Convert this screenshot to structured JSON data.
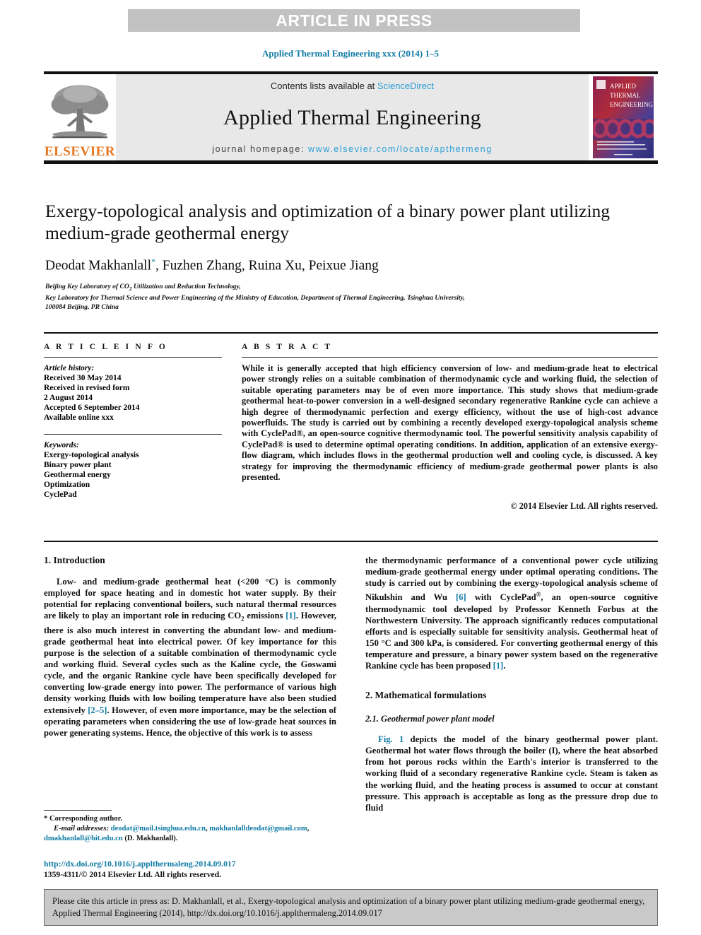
{
  "banner": {
    "text": "ARTICLE IN PRESS"
  },
  "running_head": "Applied Thermal Engineering xxx (2014) 1–5",
  "masthead": {
    "contents_prefix": "Contents lists available at ",
    "sciencedirect": "ScienceDirect",
    "journal_name": "Applied Thermal Engineering",
    "homepage_label": "journal homepage: ",
    "homepage_url": "www.elsevier.com/locate/apthermeng",
    "publisher": "ELSEVIER",
    "cover_title_lines": [
      "APPLIED",
      "THERMAL",
      "ENGINEERING"
    ],
    "link_color": "#2b9fd6",
    "band_color": "#e8e8e8"
  },
  "article": {
    "title": "Exergy-topological analysis and optimization of a binary power plant utilizing medium-grade geothermal energy",
    "authors": "Deodat Makhanlall",
    "corresponding_marker": "*",
    "authors_rest": ", Fuzhen Zhang, Ruina Xu, Peixue Jiang",
    "affiliations": [
      "Beijing Key Laboratory of CO2 Utilization and Reduction Technology,",
      "Key Laboratory for Thermal Science and Power Engineering of the Ministry of Education, Department of Thermal Engineering, Tsinghua University,",
      "100084 Beijing, PR China"
    ]
  },
  "info": {
    "heading": "A R T I C L E    I N F O",
    "history_label": "Article history:",
    "history": [
      "Received 30 May 2014",
      "Received in revised form",
      "2 August 2014",
      "Accepted 6 September 2014",
      "Available online xxx"
    ],
    "keywords_label": "Keywords:",
    "keywords": [
      "Exergy-topological analysis",
      "Binary power plant",
      "Geothermal energy",
      "Optimization",
      "CyclePad"
    ]
  },
  "abstract": {
    "heading": "A B S T R A C T",
    "text": "While it is generally accepted that high efficiency conversion of low- and medium-grade heat to electrical power strongly relies on a suitable combination of thermodynamic cycle and working fluid, the selection of suitable operating parameters may be of even more importance. This study shows that medium-grade geothermal heat-to-power conversion in a well-designed secondary regenerative Rankine cycle can achieve a high degree of thermodynamic perfection and exergy efficiency, without the use of high-cost advance powerfluids. The study is carried out by combining a recently developed exergy-topological analysis scheme with CyclePad®, an open-source cognitive thermodynamic tool. The powerful sensitivity analysis capability of CyclePad® is used to determine optimal operating conditions. In addition, application of an extensive exergy-flow diagram, which includes flows in the geothermal production well and cooling cycle, is discussed. A key strategy for improving the thermodynamic efficiency of medium-grade geothermal power plants is also presented.",
    "copyright": "© 2014 Elsevier Ltd. All rights reserved."
  },
  "body": {
    "section1_heading": "1. Introduction",
    "section1_p1_a": "Low- and medium-grade geothermal heat (<200 °C) is commonly employed for space heating and in domestic hot water supply. By their potential for replacing conventional boilers, such natural thermal resources are likely to play an important role in reducing CO",
    "section1_p1_sub": "2",
    "section1_p1_b": " emissions ",
    "ref1": "[1]",
    "section1_p1_c": ". However, there is also much interest in converting the abundant low- and medium-grade geothermal heat into electrical power. Of key importance for this purpose is the selection of a suitable combination of thermodynamic cycle and working fluid. Several cycles such as the Kaline cycle, the Goswami cycle, and the organic Rankine cycle have been specifically developed for converting low-grade energy into power. The performance of various high density working fluids with low boiling temperature have also been studied extensively ",
    "ref2_5": "[2–5]",
    "section1_p1_d": ". However, of even more importance, may be the selection of operating parameters when considering the use of low-grade heat sources in power generating systems. Hence, the objective of this work is to assess",
    "col2_p1_a": "the thermodynamic performance of a conventional power cycle utilizing medium-grade geothermal energy under optimal operating conditions. The study is carried out by combining the exergy-topological analysis scheme of Nikulshin and Wu ",
    "ref6": "[6]",
    "col2_p1_b": " with CyclePad",
    "col2_p1_c": ", an open-source cognitive thermodynamic tool developed by Professor Kenneth Forbus at the Northwestern University. The approach significantly reduces computational efforts and is especially suitable for sensitivity analysis. Geothermal heat of 150 °C and 300 kPa, is considered. For converting geothermal energy of this temperature and pressure, a binary power system based on the regenerative Rankine cycle has been proposed ",
    "ref1b": "[1]",
    "col2_p1_d": ".",
    "section2_heading": "2. Mathematical formulations",
    "section2_1_heading": "2.1. Geothermal power plant model",
    "fig1_ref": "Fig. 1",
    "section2_p1": " depicts the model of the binary geothermal power plant. Geothermal hot water flows through the boiler (I), where the heat absorbed from hot porous rocks within the Earth's interior is transferred to the working fluid of a secondary regenerative Rankine cycle. Steam is taken as the working fluid, and the heating process is assumed to occur at constant pressure. This approach is acceptable as long as the pressure drop due to fluid"
  },
  "footnote": {
    "star": "*",
    "corresponding": " Corresponding author.",
    "email_label": "E-mail addresses:",
    "emails": [
      "deodat@mail.tsinghua.edu.cn",
      "makhanlalldeodat@gmail.com",
      "dmakhanlall@hit.edu.cn"
    ],
    "email_suffix": " (D. Makhanlall).",
    "doi_url": "http://dx.doi.org/10.1016/j.applthermaleng.2014.09.017",
    "issn_line": "1359-4311/© 2014 Elsevier Ltd. All rights reserved."
  },
  "cite_box": {
    "text": "Please cite this article in press as: D. Makhanlall, et al., Exergy-topological analysis and optimization of a binary power plant utilizing medium-grade geothermal energy, Applied Thermal Engineering (2014), http://dx.doi.org/10.1016/j.applthermaleng.2014.09.017"
  }
}
